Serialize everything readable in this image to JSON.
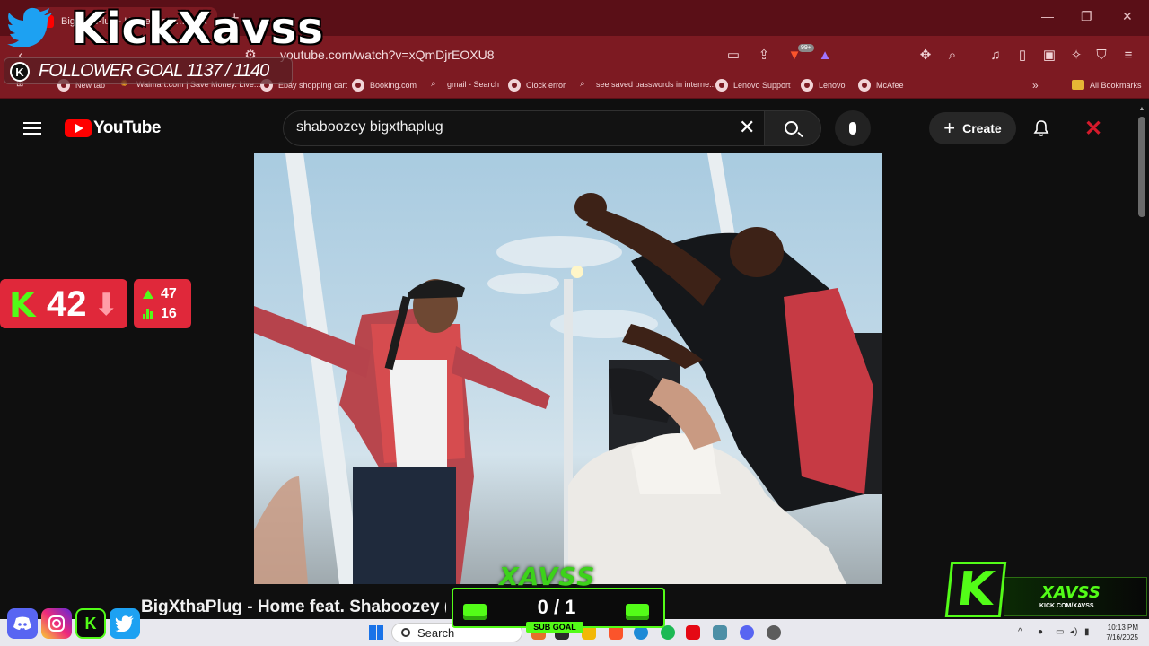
{
  "browser": {
    "tab_title": "BigXthaPlug - Home feat. Shaboozey (Offi",
    "url": "youtube.com/watch?v=xQmDjrEOXU8",
    "brave_badge": "99+",
    "bookmarks": [
      {
        "label": "New tab"
      },
      {
        "label": "Walmart.com | Save Money. Live..."
      },
      {
        "label": "Ebay shopping cart"
      },
      {
        "label": "Booking.com"
      },
      {
        "label": "gmail - Search"
      },
      {
        "label": "Clock error"
      },
      {
        "label": "see saved passwords in interne..."
      },
      {
        "label": "Lenovo Support"
      },
      {
        "label": "Lenovo"
      },
      {
        "label": "McAfee"
      }
    ],
    "all_bookmarks": "All Bookmarks",
    "more_bookmarks": "»"
  },
  "youtube": {
    "logo_text": "YouTube",
    "search_value": "shaboozey bigxthaplug",
    "create_label": "Create",
    "video_title": "BigXthaPlug - Home feat. Shaboozey (Offi"
  },
  "overlay": {
    "streamer_name": "KickXavss",
    "follower_goal": "FOLLOWER GOAL 1137 / 1140",
    "kick_letter": "K",
    "viewer_count": "42",
    "stat_up": "47",
    "stat_bars": "16",
    "sub_title": "XAVSS",
    "sub_count": "0 / 1",
    "sub_label": "SUB GOAL",
    "brand_name": "XAVSS",
    "brand_url": "KICK.COM/XAVSS"
  },
  "taskbar": {
    "search_label": "Search",
    "time": "10:13 PM",
    "date": "7/16/2025"
  },
  "colors": {
    "chrome_dark": "#5a0f17",
    "chrome": "#7d1a22",
    "kick_green": "#53fc18",
    "overlay_red": "#e0283a",
    "youtube_red": "#ff0000"
  }
}
